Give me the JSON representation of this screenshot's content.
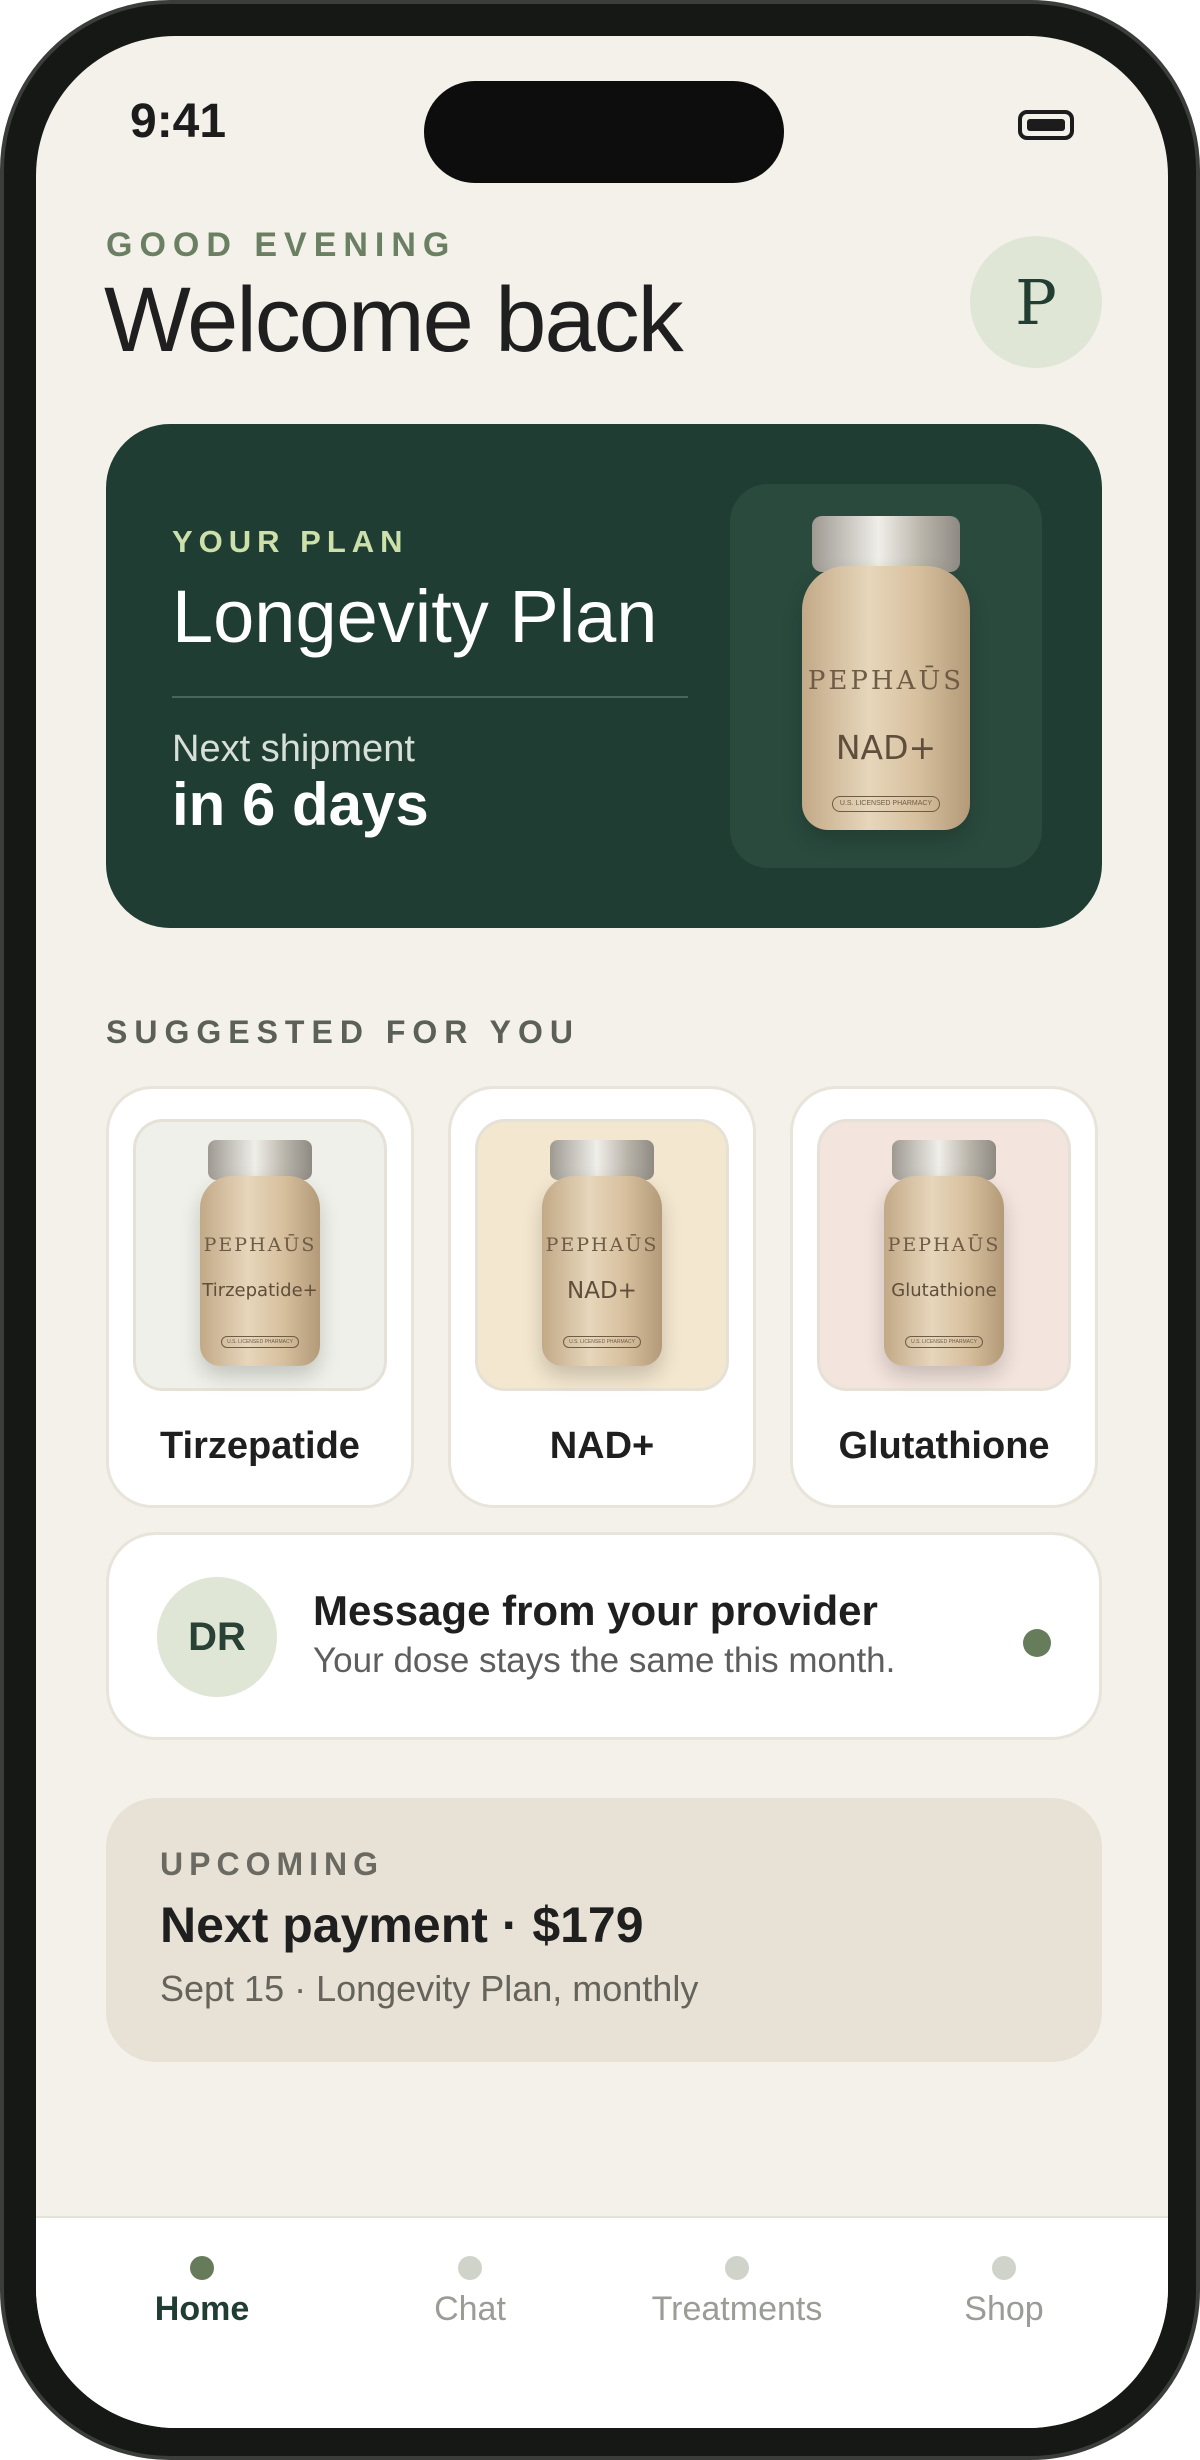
{
  "status_bar": {
    "time": "9:41",
    "battery_icon": "battery-icon"
  },
  "header": {
    "greeting": "GOOD EVENING",
    "title": "Welcome back",
    "avatar_initial": "P"
  },
  "plan": {
    "eyebrow": "YOUR PLAN",
    "name": "Longevity Plan",
    "next_label": "Next shipment",
    "next_value": "in 6 days",
    "bottle": {
      "brand": "PEPHAŪS",
      "product": "NAD+",
      "seal": "U.S. LICENSED PHARMACY"
    }
  },
  "suggested": {
    "title": "SUGGESTED FOR YOU",
    "items": [
      {
        "name": "Tirzepatide",
        "bottle_label": "Tirzepatide+",
        "brand": "PEPHAŪS",
        "seal": "U.S. LICENSED PHARMACY",
        "tile_color": "#eff0e9"
      },
      {
        "name": "NAD+",
        "bottle_label": "NAD+",
        "brand": "PEPHAŪS",
        "seal": "U.S. LICENSED PHARMACY",
        "tile_color": "#f3e7cf"
      },
      {
        "name": "Glutathione",
        "bottle_label": "Glutathione",
        "brand": "PEPHAŪS",
        "seal": "U.S. LICENSED PHARMACY",
        "tile_color": "#f3e4dd"
      }
    ]
  },
  "message": {
    "avatar": "DR",
    "title": "Message from your provider",
    "body": "Your dose stays the same this month."
  },
  "upcoming": {
    "eyebrow": "UPCOMING",
    "title": "Next payment · $179",
    "subtitle": "Sept 15 · Longevity Plan, monthly"
  },
  "tabs": [
    {
      "label": "Home",
      "active": true
    },
    {
      "label": "Chat",
      "active": false
    },
    {
      "label": "Treatments",
      "active": false
    },
    {
      "label": "Shop",
      "active": false
    }
  ],
  "colors": {
    "background": "#f4f1ea",
    "plan_card": "#1f3d32",
    "accent_green": "#6b7f62",
    "eyebrow_light": "#cde0a9"
  }
}
